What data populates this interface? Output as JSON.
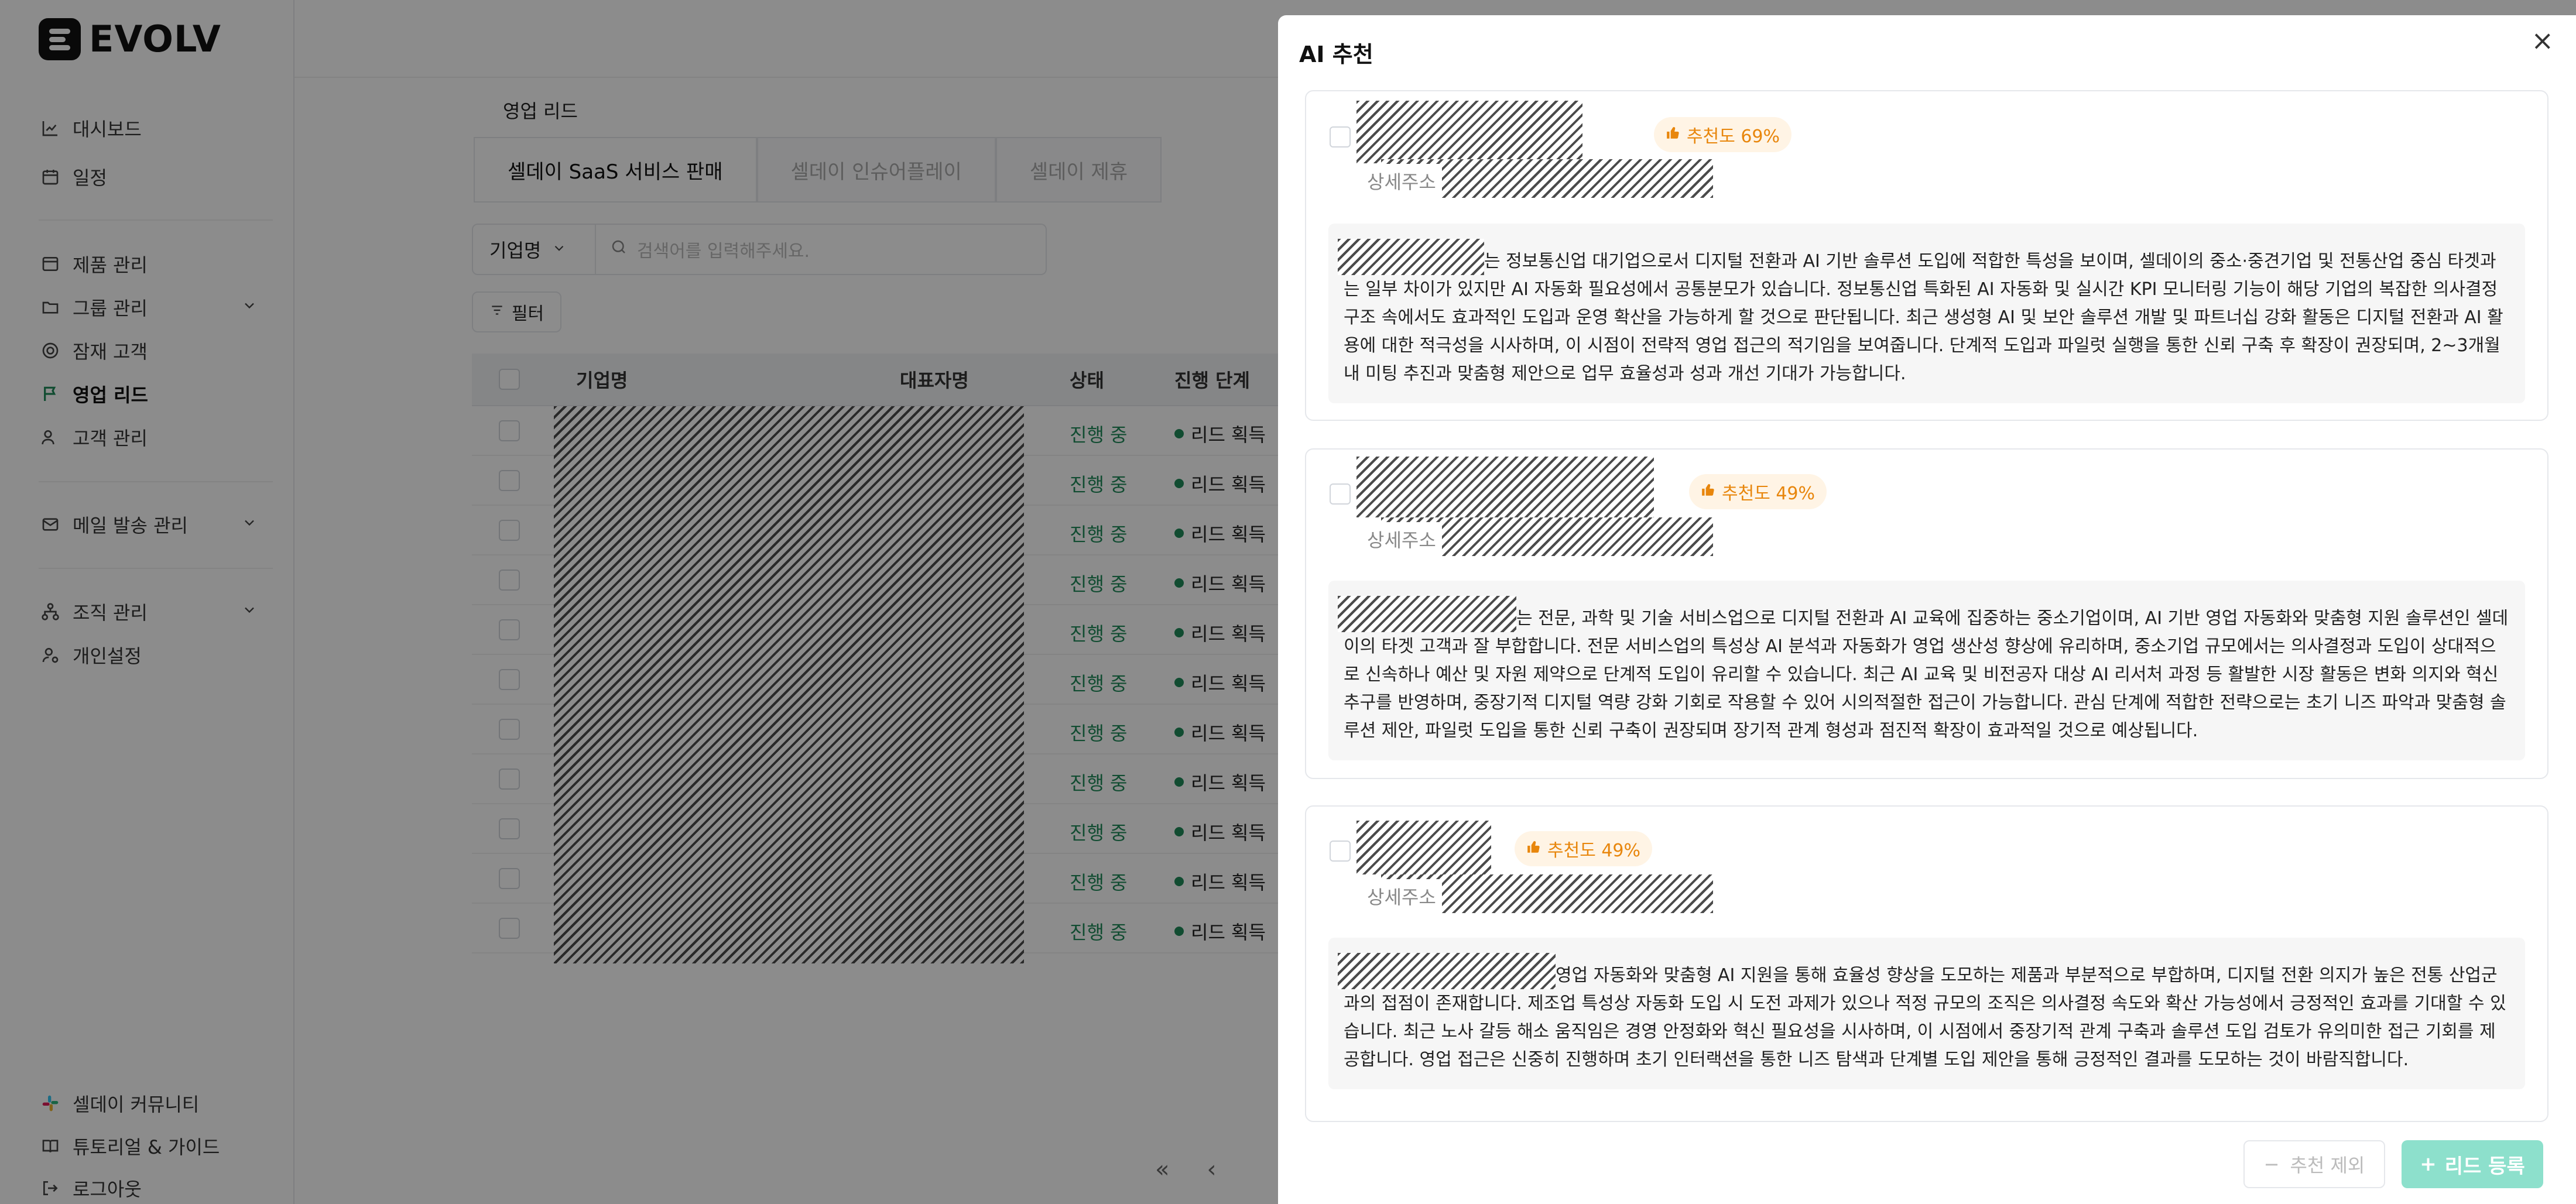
{
  "app": {
    "name": "EVOLV"
  },
  "sidebar": {
    "items": [
      {
        "label": "대시보드",
        "icon": "chart-line-icon"
      },
      {
        "label": "일정",
        "icon": "calendar-icon"
      },
      {
        "label": "제품 관리",
        "icon": "box-icon"
      },
      {
        "label": "그룹 관리",
        "icon": "folder-icon"
      },
      {
        "label": "잠재 고객",
        "icon": "target-icon"
      },
      {
        "label": "영업 리드",
        "icon": "flag-icon"
      },
      {
        "label": "고객 관리",
        "icon": "users-icon"
      },
      {
        "label": "메일 발송 관리",
        "icon": "mail-icon"
      },
      {
        "label": "조직 관리",
        "icon": "org-icon"
      },
      {
        "label": "개인설정",
        "icon": "user-settings-icon"
      }
    ],
    "footer": [
      {
        "label": "셀데이 커뮤니티",
        "icon": "slack-icon"
      },
      {
        "label": "튜토리얼 & 가이드",
        "icon": "book-icon"
      },
      {
        "label": "로그아웃",
        "icon": "logout-icon"
      }
    ]
  },
  "main": {
    "page_title": "영업 리드",
    "tabs": [
      "셀데이 SaaS 서비스 판매",
      "셀데이 인슈어플레이",
      "셀데이 제휴"
    ],
    "filter_select": "기업명",
    "search_placeholder": "검색어를 입력해주세요.",
    "filter_button": "필터",
    "columns": [
      "기업명",
      "대표자명",
      "상태",
      "진행 단계"
    ],
    "rows": [
      {
        "status": "진행 중",
        "stage": "리드 획득"
      },
      {
        "status": "진행 중",
        "stage": "리드 획득"
      },
      {
        "status": "진행 중",
        "stage": "리드 획득"
      },
      {
        "status": "진행 중",
        "stage": "리드 획득"
      },
      {
        "status": "진행 중",
        "stage": "리드 획득"
      },
      {
        "status": "진행 중",
        "stage": "리드 획득"
      },
      {
        "status": "진행 중",
        "stage": "리드 획득"
      },
      {
        "status": "진행 중",
        "stage": "리드 획득"
      },
      {
        "status": "진행 중",
        "stage": "리드 획득"
      },
      {
        "status": "진행 중",
        "stage": "리드 획득"
      },
      {
        "status": "진행 중",
        "stage": "리드 획득"
      }
    ]
  },
  "drawer": {
    "title": "AI 추천",
    "cards": [
      {
        "score": "추천도 69%",
        "address_label": "상세주소",
        "description": "는 정보통신업 대기업으로서 디지털 전환과 AI 기반 솔루션 도입에 적합한 특성을 보이며, 셀데이의 중소·중견기업 및 전통산업 중심 타겟과는 일부 차이가 있지만 AI 자동화 필요성에서 공통분모가 있습니다. 정보통신업 특화된 AI 자동화 및 실시간 KPI 모니터링 기능이 해당 기업의 복잡한 의사결정 구조 속에서도 효과적인 도입과 운영 확산을 가능하게 할 것으로 판단됩니다. 최근 생성형 AI 및 보안 솔루션 개발 및 파트너십 강화 활동은 디지털 전환과 AI 활용에 대한 적극성을 시사하며, 이 시점이 전략적 영업 접근의 적기임을 보여줍니다. 단계적 도입과 파일럿 실행을 통한 신뢰 구축 후 확장이 권장되며, 2~3개월 내 미팅 추진과 맞춤형 제안으로 업무 효율성과 성과 개선 기대가 가능합니다."
      },
      {
        "score": "추천도 49%",
        "address_label": "상세주소",
        "description": "는 전문, 과학 및 기술 서비스업으로 디지털 전환과 AI 교육에 집중하는 중소기업이며, AI 기반 영업 자동화와 맞춤형 지원 솔루션인 셀데이의 타겟 고객과 잘 부합합니다. 전문 서비스업의 특성상 AI 분석과 자동화가 영업 생산성 향상에 유리하며, 중소기업 규모에서는 의사결정과 도입이 상대적으로 신속하나 예산 및 자원 제약으로 단계적 도입이 유리할 수 있습니다. 최근 AI 교육 및 비전공자 대상 AI 리서처 과정 등 활발한 시장 활동은 변화 의지와 혁신 추구를 반영하며, 중장기적 디지털 역량 강화 기회로 작용할 수 있어 시의적절한 접근이 가능합니다. 관심 단계에 적합한 전략으로는 초기 니즈 파악과 맞춤형 솔루션 제안, 파일럿 도입을 통한 신뢰 구축이 권장되며 장기적 관계 형성과 점진적 확장이 효과적일 것으로 예상됩니다."
      },
      {
        "score": "추천도 49%",
        "address_label": "상세주소",
        "description": "영업 자동화와 맞춤형 AI 지원을 통해 효율성 향상을 도모하는 제품과 부분적으로 부합하며, 디지털 전환 의지가 높은 전통 산업군과의 접점이 존재합니다. 제조업 특성상 자동화 도입 시 도전 과제가 있으나 적정 규모의 조직은 의사결정 속도와 확산 가능성에서 긍정적인 효과를 기대할 수 있습니다. 최근 노사 갈등 해소 움직임은 경영 안정화와 혁신 필요성을 시사하며, 이 시점에서 중장기적 관계 구축과 솔루션 도입 검토가 유의미한 접근 기회를 제공합니다. 영업 접근은 신중히 진행하며 초기 인터랙션을 통한 니즈 탐색과 단계별 도입 제안을 통해 긍정적인 결과를 도모하는 것이 바람직합니다."
      }
    ],
    "exclude_button": "추천 제외",
    "register_button": "리드 등록"
  }
}
